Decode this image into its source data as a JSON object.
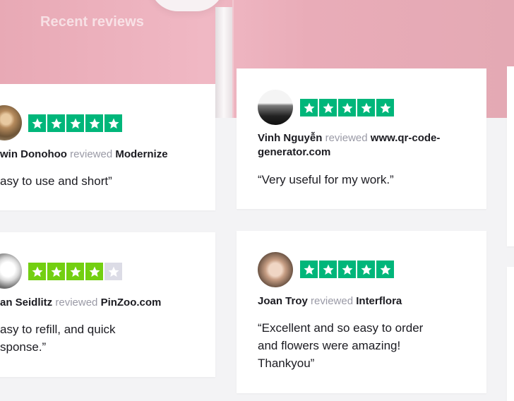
{
  "section": {
    "title": "Recent reviews"
  },
  "reviews": [
    {
      "name": "win Donohoo",
      "reviewed_word": "reviewed",
      "company": "Modernize",
      "text": "asy to use and short”",
      "rating": 5
    },
    {
      "name": "Vinh Nguyễn",
      "reviewed_word": "reviewed",
      "company_line1": "www.qr-code-",
      "company_line2": "generator.com",
      "text": "“Very useful for my work.”",
      "rating": 5
    },
    {
      "name": "an Seidlitz",
      "reviewed_word": "reviewed",
      "company": "PinZoo.com",
      "text_line1": "asy to refill, and quick",
      "text_line2": "sponse.”",
      "rating": 4
    },
    {
      "name": "Joan Troy",
      "reviewed_word": "reviewed",
      "company": "Interflora",
      "text_line1": "“Excellent and so easy to order",
      "text_line2": "and flowers were amazing!",
      "text_line3": "Thankyou”",
      "rating": 5
    }
  ],
  "colors": {
    "star_filled": "#00b67a",
    "star_empty": "#dcdce6",
    "hero_pink": "#eeb4c0",
    "reviewed_grey": "#9a9aa6"
  },
  "icons": [
    "star-icon",
    "avatar-photo"
  ]
}
